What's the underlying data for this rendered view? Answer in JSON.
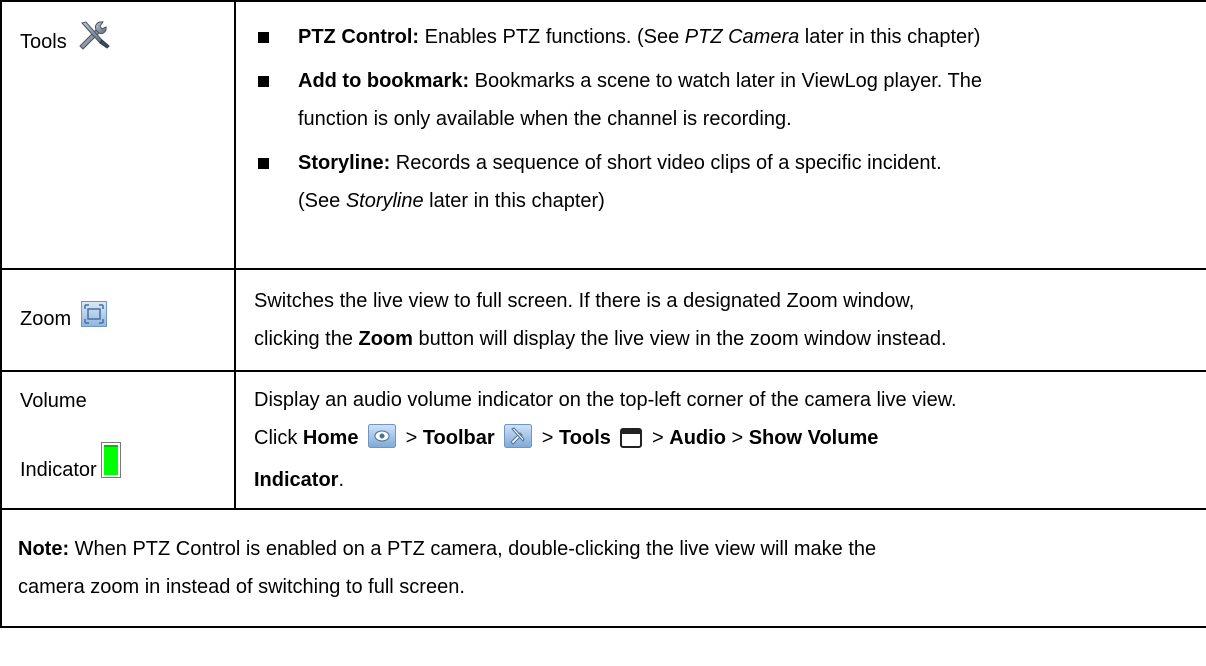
{
  "rows": {
    "tools": {
      "label": "Tools",
      "bullets": [
        {
          "term": "PTZ Control:",
          "text1": " Enables PTZ functions. (See ",
          "italic": "PTZ Camera",
          "text2": " later in this chapter)"
        },
        {
          "term": "Add to bookmark:",
          "text1": " Bookmarks a scene to watch later in ViewLog player. The",
          "line2": "function is only available when the channel is recording."
        },
        {
          "term": "Storyline:",
          "text1": " Records a sequence of short video clips of a specific incident.",
          "line2_pre": "(See ",
          "italic": "Storyline",
          "line2_post": " later in this chapter)"
        }
      ]
    },
    "zoom": {
      "label": "Zoom",
      "line1": "Switches the live view to full screen. If there is a designated Zoom window,",
      "line2_pre": "clicking the ",
      "line2_bold": "Zoom",
      "line2_post": " button will display the live view in the zoom window instead."
    },
    "volume": {
      "label1": "Volume",
      "label2": "Indicator",
      "line1": "Display an audio volume indicator on the top-left corner of the camera live view.",
      "click": "Click ",
      "home": "Home",
      "sep": " > ",
      "toolbar": "Toolbar",
      "tools": "Tools",
      "audio": "Audio",
      "show": "Show Volume",
      "indicator": "Indicator",
      "end": "."
    }
  },
  "note": {
    "label": "Note:",
    "line1": " When PTZ Control is enabled on a PTZ camera, double-clicking the live view will make the",
    "line2": "camera zoom in instead of switching to full screen."
  },
  "icons": {
    "tools_icon": "wrench-screwdriver-icon",
    "zoom_icon": "fullscreen-icon",
    "volume_icon": "volume-indicator-icon",
    "home_icon": "eye-icon",
    "window_icon": "window-icon"
  },
  "colors": {
    "volume_green": "#00ff00",
    "icon_blue": "#5b8fc9"
  }
}
